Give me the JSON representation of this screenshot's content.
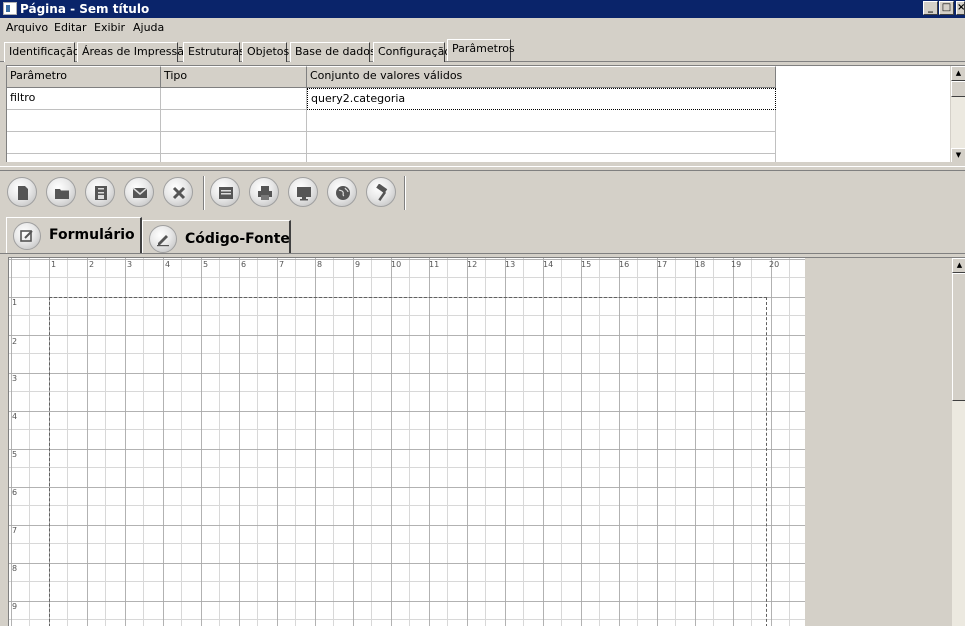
{
  "window": {
    "title": "Página - Sem título",
    "controls": {
      "minimize": "_",
      "maximize": "□",
      "close": "×"
    }
  },
  "menu": [
    "Arquivo",
    "Editar",
    "Exibir",
    "Ajuda"
  ],
  "tabs": {
    "items": [
      "Identificação",
      "Áreas de Impressão",
      "Estruturas",
      "Objetos",
      "Base de dados",
      "Configuração",
      "Parâmetros"
    ],
    "active": "Parâmetros"
  },
  "params_grid": {
    "columns": [
      "Parâmetro",
      "Tipo",
      "Conjunto de valores válidos"
    ],
    "rows": [
      [
        "filtro",
        "",
        "query2.categoria"
      ],
      [
        "",
        "",
        ""
      ],
      [
        "",
        "",
        ""
      ]
    ]
  },
  "toolbar": {
    "buttons": [
      "new-icon",
      "open-folder-icon",
      "save-icon",
      "email-icon",
      "delete-icon",
      "print-preview-icon",
      "print-icon",
      "monitor-icon",
      "globe-icon",
      "hammer-icon"
    ]
  },
  "editor_tabs": {
    "items": [
      "Formulário",
      "Código-Fonte"
    ],
    "active": "Formulário"
  },
  "ruler": {
    "horizontal": [
      "1",
      "2",
      "3",
      "4",
      "5",
      "6",
      "7",
      "8",
      "9",
      "10",
      "11",
      "12",
      "13",
      "14",
      "15",
      "16",
      "17",
      "18",
      "19",
      "20"
    ],
    "vertical": [
      "1",
      "2",
      "3",
      "4",
      "5",
      "6",
      "7",
      "8",
      "9"
    ]
  }
}
